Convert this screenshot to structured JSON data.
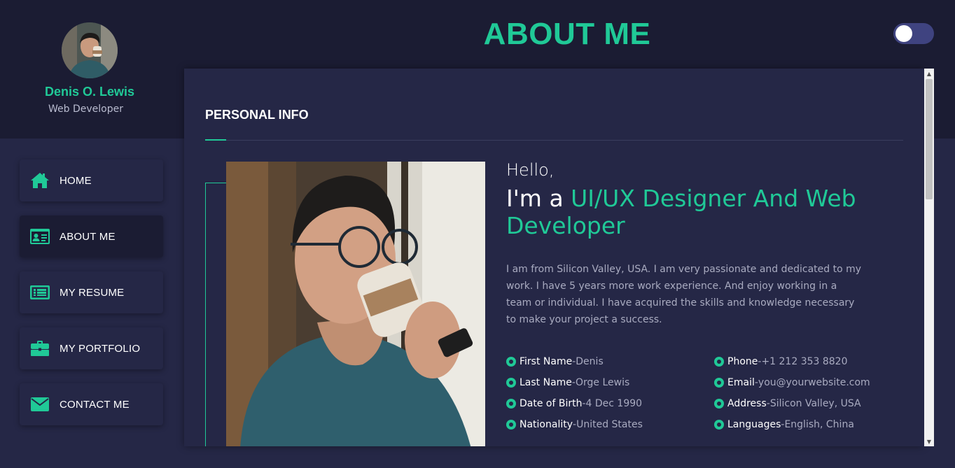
{
  "profile": {
    "name": "Denis O. Lewis",
    "role": "Web Developer"
  },
  "page": {
    "title": "ABOUT ME"
  },
  "theme_toggle": {
    "state": "off"
  },
  "nav": {
    "items": [
      {
        "label": "HOME",
        "icon": "home-icon",
        "active": false
      },
      {
        "label": "ABOUT ME",
        "icon": "id-card-icon",
        "active": true
      },
      {
        "label": "MY RESUME",
        "icon": "resume-icon",
        "active": false
      },
      {
        "label": "MY PORTFOLIO",
        "icon": "briefcase-icon",
        "active": false
      },
      {
        "label": "CONTACT ME",
        "icon": "envelope-icon",
        "active": false
      }
    ]
  },
  "section": {
    "title": "PERSONAL INFO",
    "hello": "Hello,",
    "headline_prefix": "I'm a ",
    "headline_accent": "UI/UX Designer And Web Developer",
    "bio": "I am from Silicon Valley, USA. I am very passionate and dedicated to my work. I have 5 years more work experience. And enjoy working in a team or individual. I have acquired the skills and knowledge necessary to make your project a success."
  },
  "info": {
    "left": [
      {
        "key": "First Name",
        "value": "Denis"
      },
      {
        "key": "Last Name",
        "value": "Orge Lewis"
      },
      {
        "key": "Date of Birth",
        "value": "4 Dec 1990"
      },
      {
        "key": "Nationality",
        "value": "United States"
      }
    ],
    "right": [
      {
        "key": "Phone",
        "value": "+1 212 353 8820"
      },
      {
        "key": "Email",
        "value": "you@yourwebsite.com"
      },
      {
        "key": "Address",
        "value": "Silicon Valley, USA"
      },
      {
        "key": "Languages",
        "value": "English, China"
      }
    ],
    "separator": " - "
  },
  "colors": {
    "accent": "#20c997",
    "background": "#252746",
    "header_background": "#1b1c33",
    "toggle_track": "#3f4380",
    "muted_text": "#a9abc0"
  }
}
